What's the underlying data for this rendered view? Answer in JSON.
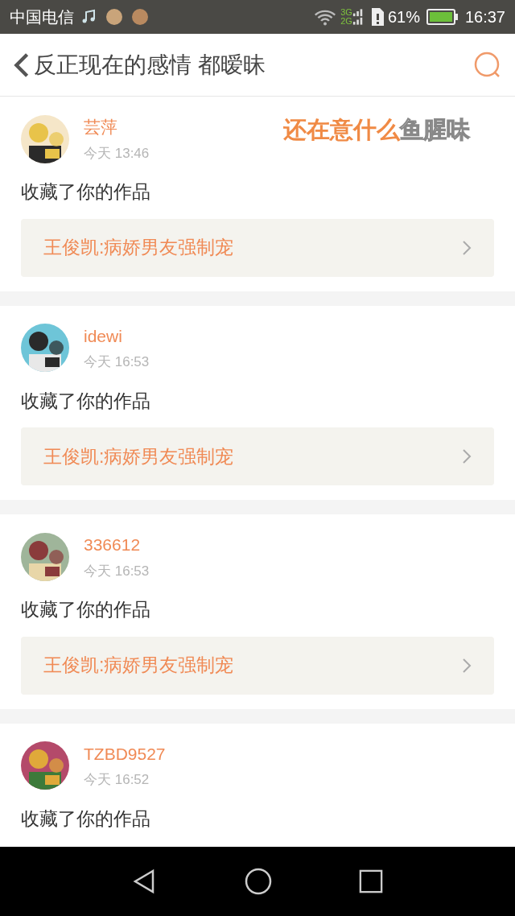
{
  "status_bar": {
    "carrier": "中国电信",
    "network_1": "3G",
    "network_2": "2G",
    "battery": "61%",
    "time": "16:37"
  },
  "header": {
    "title": "反正现在的感情 都暧昧"
  },
  "lyric_overlay": {
    "sung": "还在意什么",
    "unsung": "鱼腥味"
  },
  "notifications": [
    {
      "user": "芸萍",
      "time": "今天 13:46",
      "action": "收藏了你的作品",
      "work": "王俊凯:病娇男友强制宠"
    },
    {
      "user": "idewi",
      "time": "今天 16:53",
      "action": "收藏了你的作品",
      "work": "王俊凯:病娇男友强制宠"
    },
    {
      "user": "336612",
      "time": "今天 16:53",
      "action": "收藏了你的作品",
      "work": "王俊凯:病娇男友强制宠"
    },
    {
      "user": "TZBD9527",
      "time": "今天 16:52",
      "action": "收藏了你的作品"
    }
  ]
}
